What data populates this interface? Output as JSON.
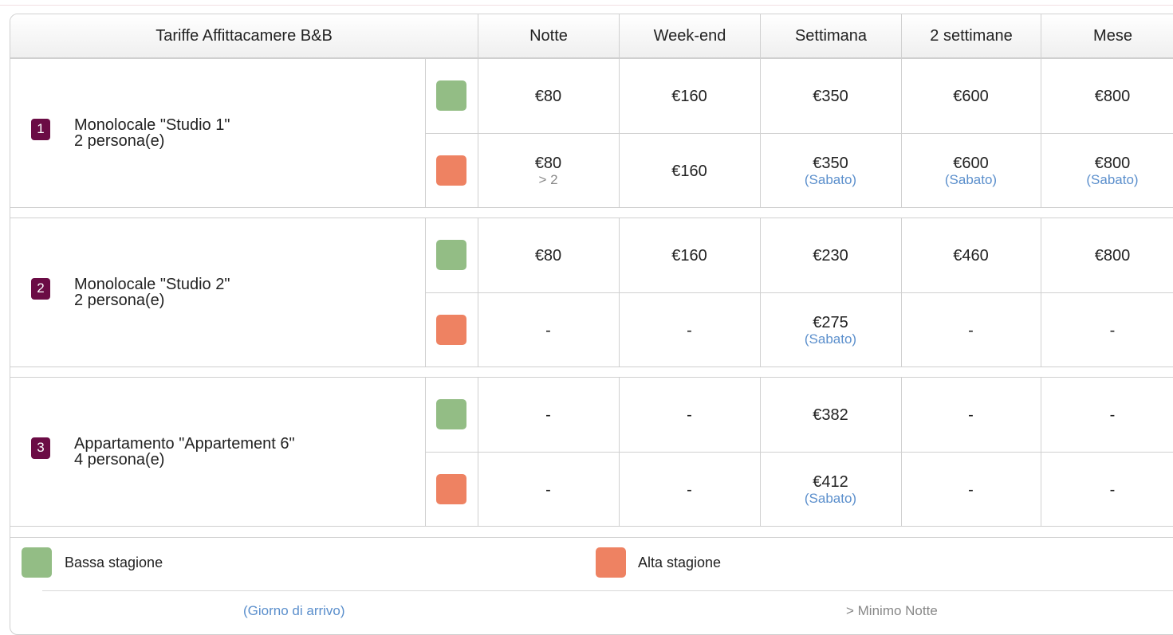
{
  "header": {
    "title": "Tariffe Affittacamere B&B",
    "columns": [
      "Notte",
      "Week-end",
      "Settimana",
      "2 settimane",
      "Mese"
    ]
  },
  "rooms": [
    {
      "number": "1",
      "name": "Monolocale \"Studio 1\"",
      "persons": "2 persona(e)",
      "low": [
        {
          "price": "€80",
          "note": ""
        },
        {
          "price": "€160",
          "note": ""
        },
        {
          "price": "€350",
          "note": ""
        },
        {
          "price": "€600",
          "note": ""
        },
        {
          "price": "€800",
          "note": ""
        }
      ],
      "high": [
        {
          "price": "€80",
          "note": "> 2"
        },
        {
          "price": "€160",
          "note": ""
        },
        {
          "price": "€350",
          "note": "(Sabato)"
        },
        {
          "price": "€600",
          "note": "(Sabato)"
        },
        {
          "price": "€800",
          "note": "(Sabato)"
        }
      ]
    },
    {
      "number": "2",
      "name": "Monolocale \"Studio 2\"",
      "persons": "2 persona(e)",
      "low": [
        {
          "price": "€80",
          "note": ""
        },
        {
          "price": "€160",
          "note": ""
        },
        {
          "price": "€230",
          "note": ""
        },
        {
          "price": "€460",
          "note": ""
        },
        {
          "price": "€800",
          "note": ""
        }
      ],
      "high": [
        {
          "price": "-",
          "note": ""
        },
        {
          "price": "-",
          "note": ""
        },
        {
          "price": "€275",
          "note": "(Sabato)"
        },
        {
          "price": "-",
          "note": ""
        },
        {
          "price": "-",
          "note": ""
        }
      ]
    },
    {
      "number": "3",
      "name": "Appartamento \"Appartement 6\"",
      "persons": "4 persona(e)",
      "low": [
        {
          "price": "-",
          "note": ""
        },
        {
          "price": "-",
          "note": ""
        },
        {
          "price": "€382",
          "note": ""
        },
        {
          "price": "-",
          "note": ""
        },
        {
          "price": "-",
          "note": ""
        }
      ],
      "high": [
        {
          "price": "-",
          "note": ""
        },
        {
          "price": "-",
          "note": ""
        },
        {
          "price": "€412",
          "note": "(Sabato)"
        },
        {
          "price": "-",
          "note": ""
        },
        {
          "price": "-",
          "note": ""
        }
      ]
    }
  ],
  "legend": {
    "low_label": "Bassa stagione",
    "high_label": "Alta stagione",
    "arrival_note": "(Giorno di arrivo)",
    "min_nights_note": "> Minimo Notte"
  },
  "colors": {
    "low_season": "#93bd85",
    "high_season": "#ee8262",
    "badge": "#6b0c45",
    "note_blue": "#5b8fcc"
  }
}
